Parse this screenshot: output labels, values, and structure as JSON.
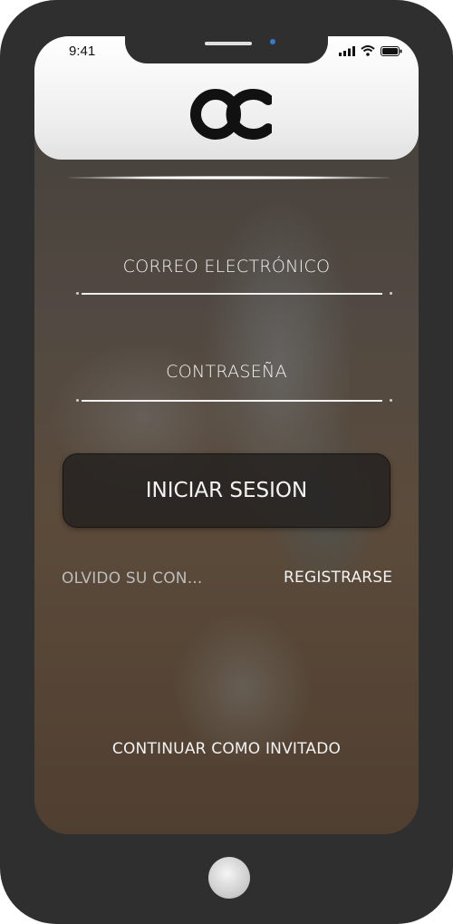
{
  "status_bar": {
    "time": "9:41"
  },
  "login": {
    "email_label": "CORREO ELECTRÓNICO",
    "password_label": "CONTRASEÑA",
    "submit_label": "INICIAR SESION",
    "forgot_label": "OLVIDO SU CON...",
    "register_label": "REGISTRARSE",
    "guest_label": "CONTINUAR COMO INVITADO"
  },
  "icons": {
    "logo": "oc-logo",
    "signal": "signal-bars-icon",
    "wifi": "wifi-icon",
    "battery": "battery-icon"
  }
}
